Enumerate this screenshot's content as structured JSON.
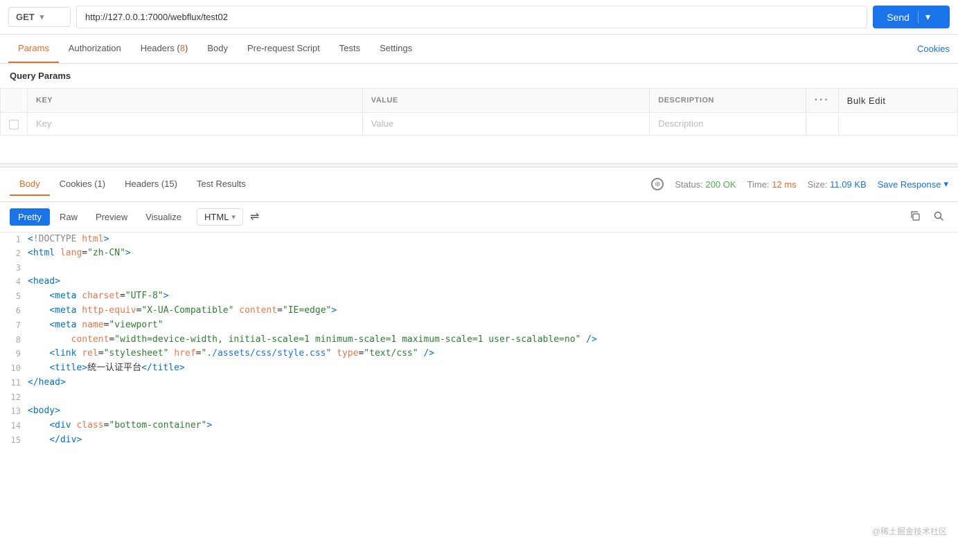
{
  "urlbar": {
    "method": "GET",
    "url": "http://127.0.0.1:7000/webflux/test02",
    "send_label": "Send",
    "arrow": "▾"
  },
  "request_tabs": [
    {
      "id": "params",
      "label": "Params",
      "active": true,
      "count": null
    },
    {
      "id": "authorization",
      "label": "Authorization",
      "active": false,
      "count": null
    },
    {
      "id": "headers",
      "label": "Headers",
      "active": false,
      "count": "8"
    },
    {
      "id": "body",
      "label": "Body",
      "active": false,
      "count": null
    },
    {
      "id": "pre-request",
      "label": "Pre-request Script",
      "active": false,
      "count": null
    },
    {
      "id": "tests",
      "label": "Tests",
      "active": false,
      "count": null
    },
    {
      "id": "settings",
      "label": "Settings",
      "active": false,
      "count": null
    }
  ],
  "cookies_link": "Cookies",
  "query_params": {
    "section_label": "Query Params",
    "columns": [
      "KEY",
      "VALUE",
      "DESCRIPTION"
    ],
    "bulk_edit": "Bulk Edit",
    "placeholder_row": {
      "key": "Key",
      "value": "Value",
      "description": "Description"
    }
  },
  "response": {
    "tabs": [
      {
        "id": "body",
        "label": "Body",
        "active": true
      },
      {
        "id": "cookies",
        "label": "Cookies (1)",
        "active": false
      },
      {
        "id": "headers",
        "label": "Headers (15)",
        "active": false
      },
      {
        "id": "test-results",
        "label": "Test Results",
        "active": false
      }
    ],
    "status_label": "Status:",
    "status_value": "200 OK",
    "time_label": "Time:",
    "time_value": "12 ms",
    "size_label": "Size:",
    "size_value": "11.09 KB",
    "save_response": "Save Response",
    "format_buttons": [
      "Pretty",
      "Raw",
      "Preview",
      "Visualize"
    ],
    "active_format": "Pretty",
    "type_select": "HTML",
    "code_lines": [
      {
        "num": 1,
        "html": "<span class='angle'>&lt;</span><span class='doctype-text'>!DOCTYPE </span><span class='doctype-html'>html</span><span class='angle'>&gt;</span>"
      },
      {
        "num": 2,
        "html": "<span class='angle'>&lt;</span><span class='tag'>html</span> <span class='attr-name'>lang</span>=<span class='attr-val'>\"zh-CN\"</span><span class='angle'>&gt;</span>"
      },
      {
        "num": 3,
        "html": ""
      },
      {
        "num": 4,
        "html": "<span class='angle'>&lt;</span><span class='tag'>head</span><span class='angle'>&gt;</span>"
      },
      {
        "num": 5,
        "html": "    <span class='angle'>&lt;</span><span class='tag'>meta</span> <span class='attr-name'>charset</span>=<span class='attr-val'>\"UTF-8\"</span><span class='angle'>&gt;</span>"
      },
      {
        "num": 6,
        "html": "    <span class='angle'>&lt;</span><span class='tag'>meta</span> <span class='attr-name'>http-equiv</span>=<span class='attr-val'>\"X-UA-Compatible\"</span> <span class='attr-name'>content</span>=<span class='attr-val'>\"IE=edge\"</span><span class='angle'>&gt;</span>"
      },
      {
        "num": 7,
        "html": "    <span class='angle'>&lt;</span><span class='tag'>meta</span> <span class='attr-name'>name</span>=<span class='attr-val'>\"viewport\"</span>"
      },
      {
        "num": 8,
        "html": "        <span class='attr-name'>content</span>=<span class='attr-val'>\"width=device-width, initial-scale=1 minimum-scale=1 maximum-scale=1 user-scalable=no\"</span> <span class='angle'>/&gt;</span>"
      },
      {
        "num": 9,
        "html": "    <span class='angle'>&lt;</span><span class='tag'>link</span> <span class='attr-name'>rel</span>=<span class='attr-val'>\"stylesheet\"</span> <span class='attr-name'>href</span>=<span class='attr-val'>\"<span style='color:#1a73e8'>./assets/css/style.css</span>\"</span> <span class='attr-name'>type</span>=<span class='attr-val'>\"text/css\"</span> <span class='angle'>/&gt;</span>"
      },
      {
        "num": 10,
        "html": "    <span class='angle'>&lt;</span><span class='tag'>title</span><span class='angle'>&gt;</span><span class='text-content'>统一认证平台</span><span class='angle'>&lt;/</span><span class='tag'>title</span><span class='angle'>&gt;</span>"
      },
      {
        "num": 11,
        "html": "<span class='angle'>&lt;/</span><span class='tag'>head</span><span class='angle'>&gt;</span>"
      },
      {
        "num": 12,
        "html": ""
      },
      {
        "num": 13,
        "html": "<span class='angle'>&lt;</span><span class='tag'>body</span><span class='angle'>&gt;</span>"
      },
      {
        "num": 14,
        "html": "    <span class='angle'>&lt;</span><span class='tag'>div</span> <span class='attr-name'>class</span>=<span class='attr-val'>\"bottom-container\"</span><span class='angle'>&gt;</span>"
      },
      {
        "num": 15,
        "html": "    <span class='angle'>&lt;/</span><span class='tag'>div</span><span class='angle'>&gt;</span>"
      }
    ]
  },
  "watermark": "@稀土掘金技术社区"
}
